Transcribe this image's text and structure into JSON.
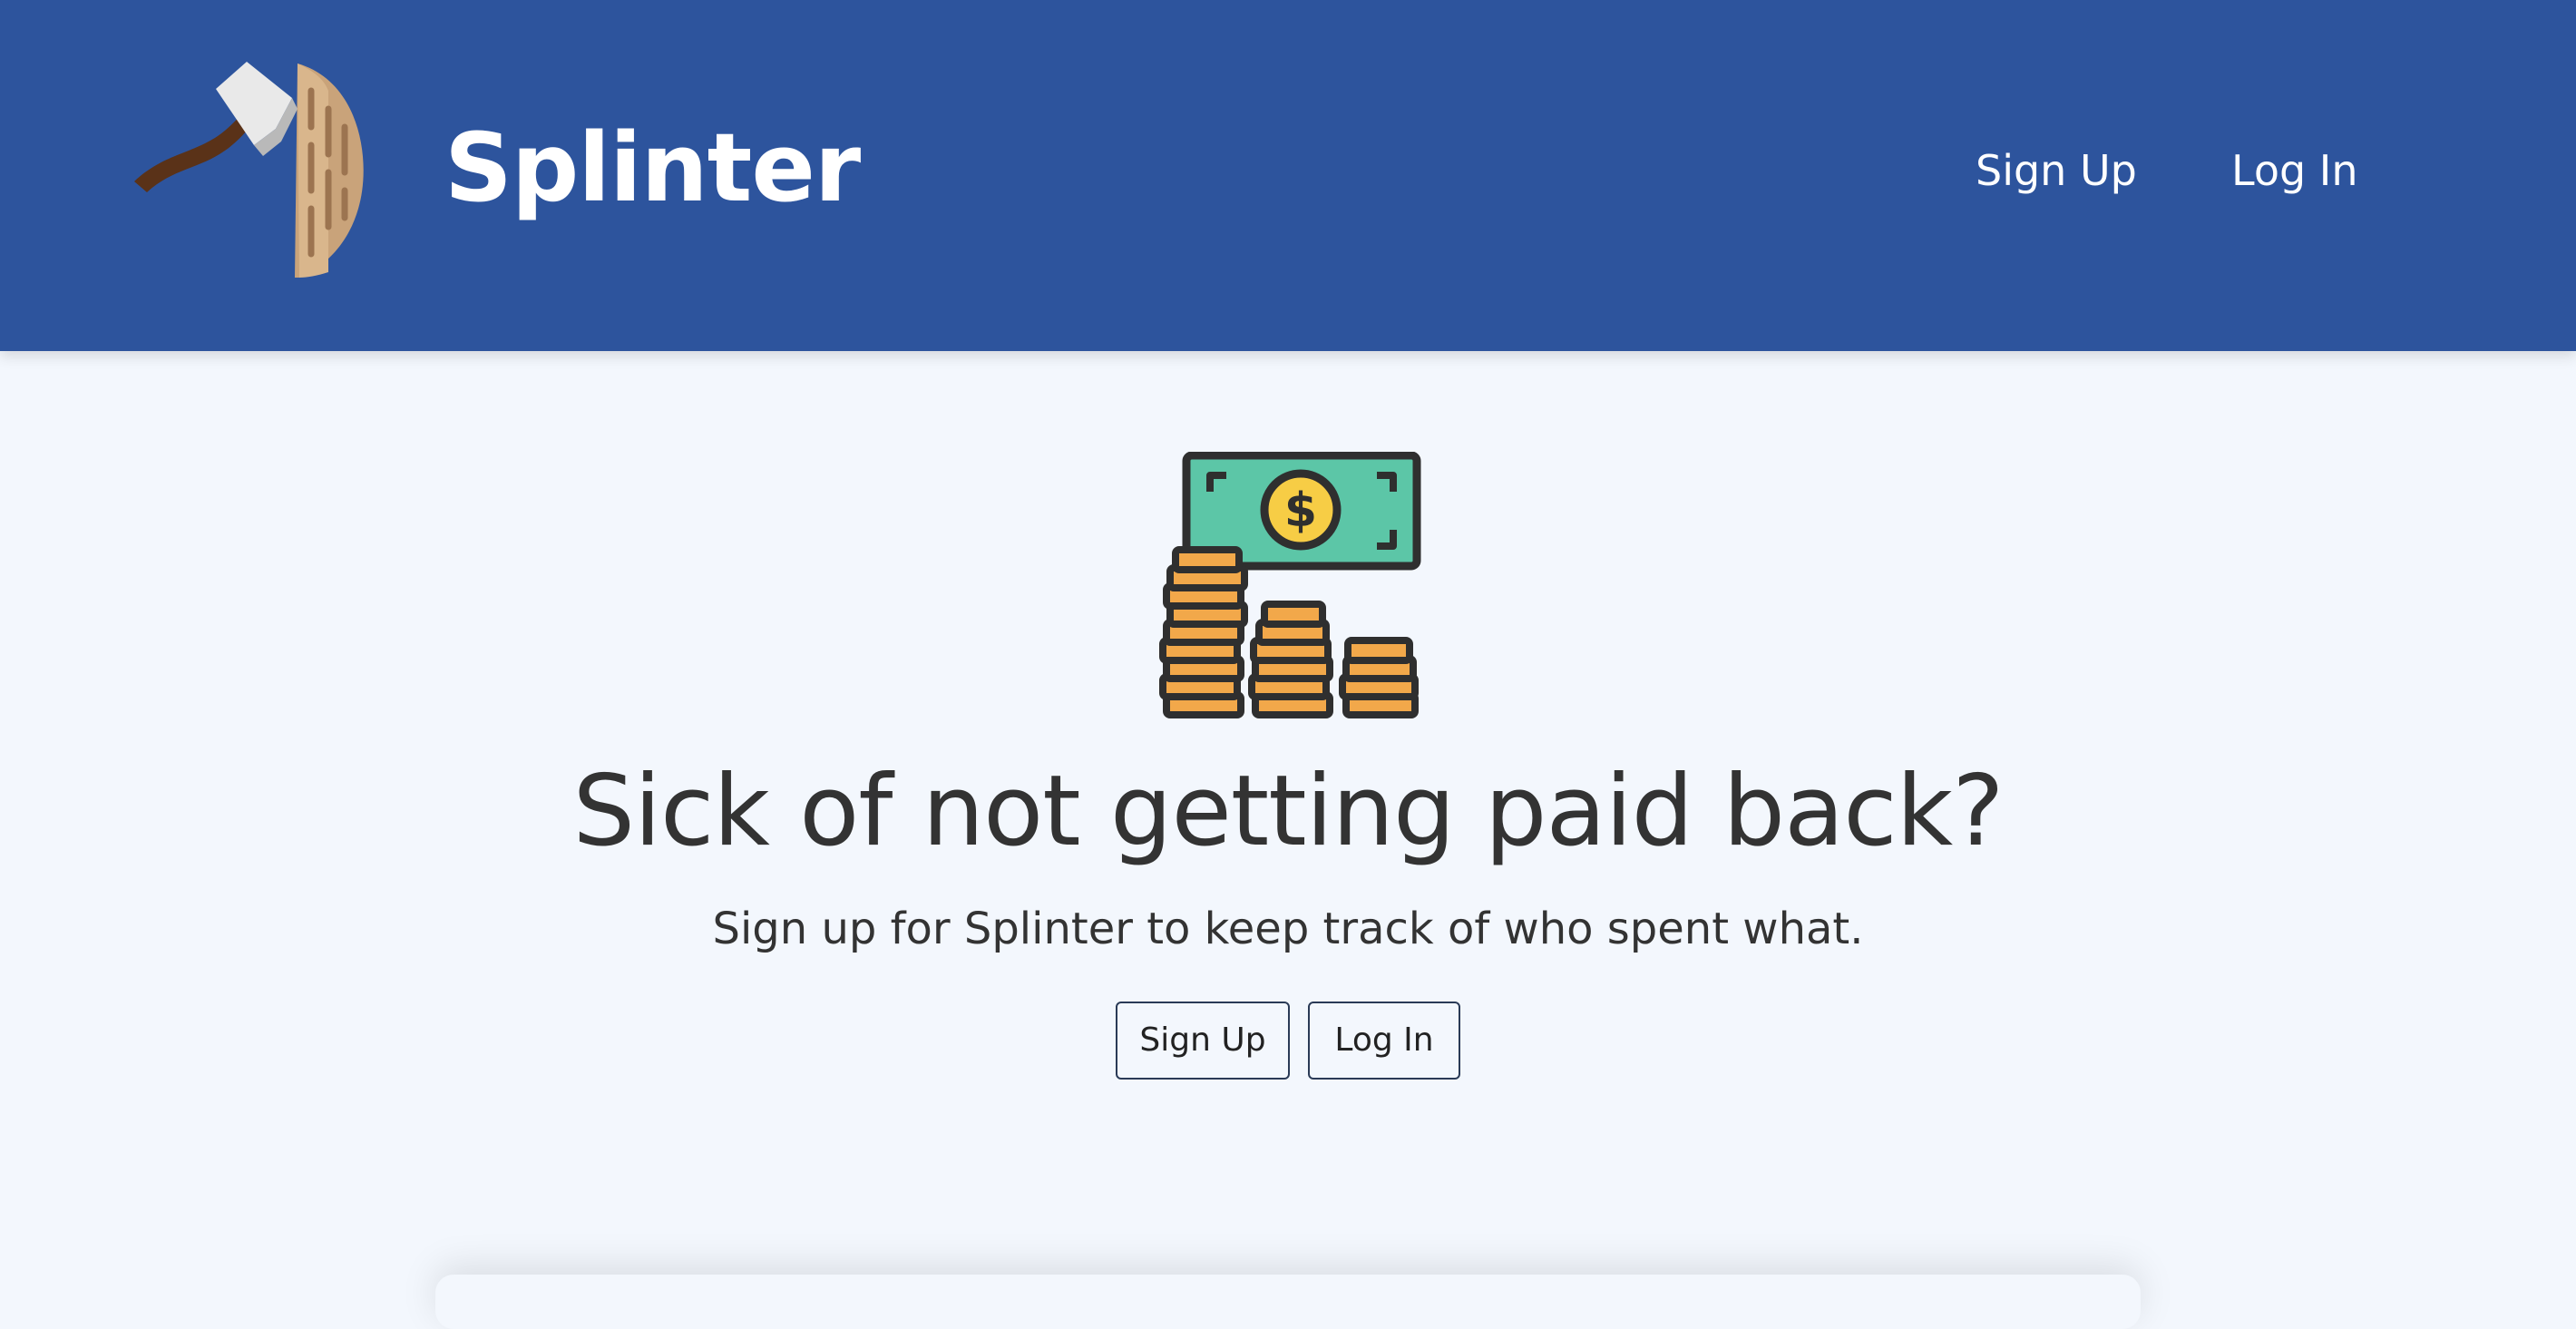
{
  "header": {
    "brand_name": "Splinter",
    "logo_icon": "axe-log-icon",
    "nav": {
      "signup_label": "Sign Up",
      "login_label": "Log In"
    }
  },
  "hero": {
    "illustration_icon": "money-bill-coins-icon",
    "title": "Sick of not getting paid back?",
    "subtitle": "Sign up for Splinter to keep track of who spent what.",
    "buttons": {
      "signup_label": "Sign Up",
      "login_label": "Log In"
    }
  },
  "colors": {
    "header_bg": "#2d549d",
    "page_bg": "#f3f7fd",
    "text": "#333333",
    "bill_green": "#5cc6a7",
    "coin_orange": "#f2a84a",
    "coin_yellow": "#f7cd45"
  }
}
